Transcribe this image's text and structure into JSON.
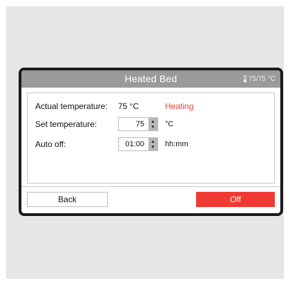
{
  "dialog": {
    "title": "Heated Bed",
    "temperature_status": "75/75 °C",
    "status_icon": "thermometer-icon"
  },
  "rows": {
    "actual": {
      "label": "Actual temperature:",
      "value": "75 °C",
      "status": "Heating"
    },
    "set": {
      "label": "Set temperature:",
      "value": "75",
      "unit": "°C"
    },
    "auto_off": {
      "label": "Auto off:",
      "value": "01:00",
      "unit": "hh:mm"
    }
  },
  "buttons": {
    "back": "Back",
    "off": "Off"
  },
  "colors": {
    "accent": "#ef3b33",
    "titlebar": "#9a9a9a",
    "frame": "#1a1a1a"
  }
}
